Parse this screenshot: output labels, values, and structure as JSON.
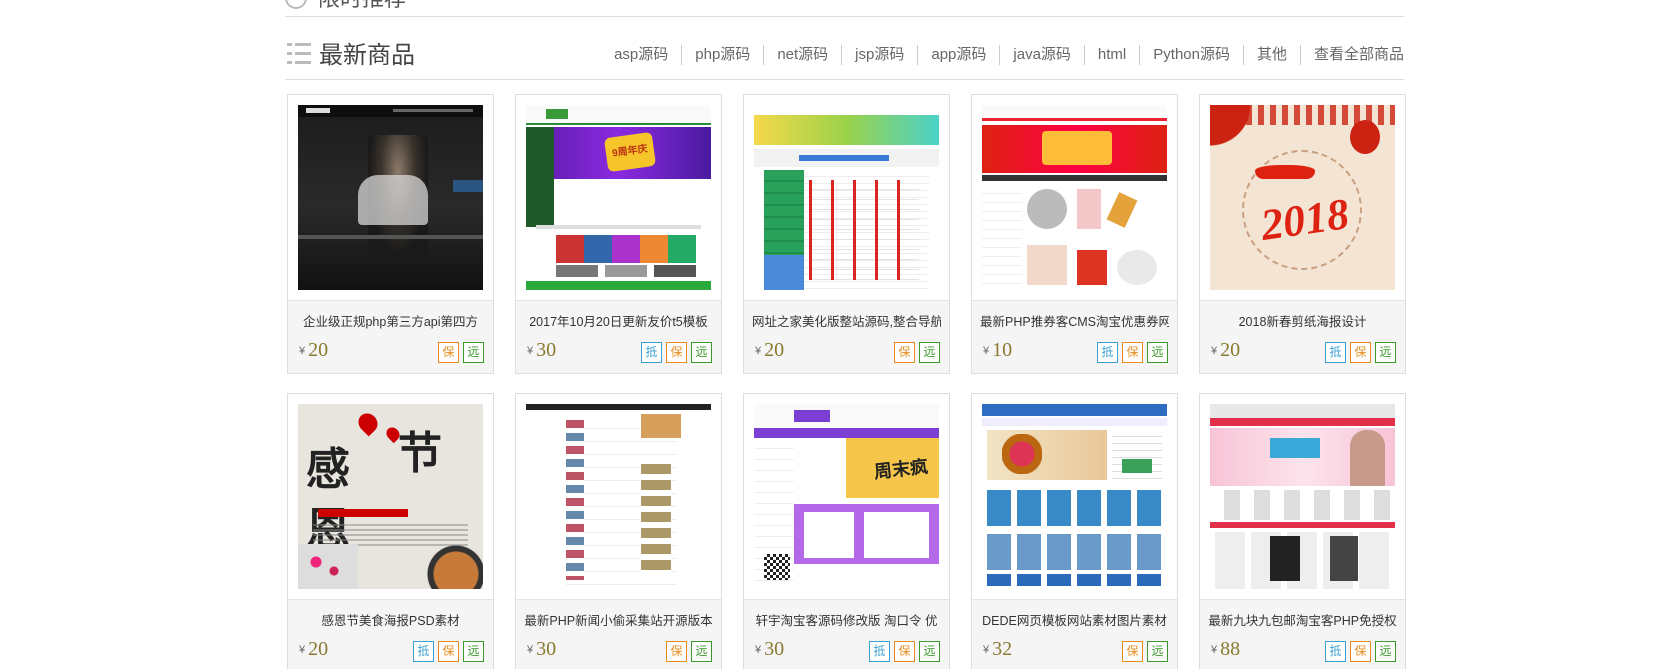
{
  "prev_section": {
    "title": "限时推荐"
  },
  "section": {
    "title": "最新商品",
    "links": [
      "asp源码",
      "php源码",
      "net源码",
      "jsp源码",
      "app源码",
      "java源码",
      "html",
      "Python源码",
      "其他",
      "查看全部商品"
    ]
  },
  "currency": "¥",
  "badge_labels": {
    "di": "抵",
    "bao": "保",
    "yuan": "远"
  },
  "products": [
    {
      "title": "企业级正规php第三方api第四方",
      "price": "20",
      "badges": [
        "bao",
        "yuan"
      ],
      "thumb": "dark-office"
    },
    {
      "title": "2017年10月20日更新友价t5模板",
      "price": "30",
      "badges": [
        "di",
        "bao",
        "yuan"
      ],
      "thumb": "purple-store"
    },
    {
      "title": "网址之家美化版整站源码,整合导航",
      "price": "20",
      "badges": [
        "bao",
        "yuan"
      ],
      "thumb": "nav-site"
    },
    {
      "title": "最新PHP推券客CMS淘宝优惠券网",
      "price": "10",
      "badges": [
        "di",
        "bao",
        "yuan"
      ],
      "thumb": "coupon-site"
    },
    {
      "title": "2018新春剪纸海报设计",
      "price": "20",
      "badges": [
        "di",
        "bao",
        "yuan"
      ],
      "thumb": "papercut-2018"
    },
    {
      "title": "感恩节美食海报PSD素材",
      "price": "20",
      "badges": [
        "di",
        "bao",
        "yuan"
      ],
      "thumb": "thanksgiving"
    },
    {
      "title": "最新PHP新闻小偷采集站开源版本",
      "price": "30",
      "badges": [
        "bao",
        "yuan"
      ],
      "thumb": "news-site"
    },
    {
      "title": "轩宇淘宝客源码修改版 淘口令 优",
      "price": "30",
      "badges": [
        "di",
        "bao",
        "yuan"
      ],
      "thumb": "taobao-purple"
    },
    {
      "title": "DEDE网页模板网站素材图片素材",
      "price": "32",
      "badges": [
        "bao",
        "yuan"
      ],
      "thumb": "dede-site"
    },
    {
      "title": "最新九块九包邮淘宝客PHP免授权",
      "price": "88",
      "badges": [
        "di",
        "bao",
        "yuan"
      ],
      "thumb": "jiukuai-site"
    }
  ],
  "thumb_text": {
    "papercut_year": "2018",
    "thanks_title_1": "感恩",
    "thanks_title_2": "节",
    "taobao_banner": "周末疯",
    "nav_banner": "9周年庆"
  }
}
